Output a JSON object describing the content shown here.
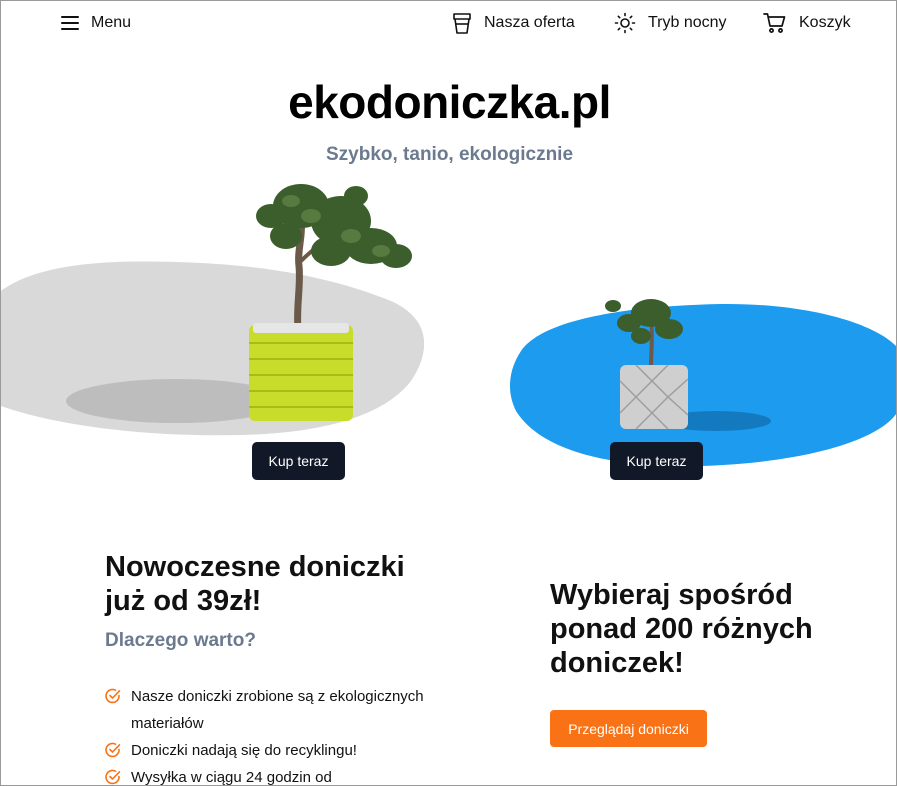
{
  "header": {
    "menu_label": "Menu",
    "offer_label": "Nasza oferta",
    "night_mode_label": "Tryb nocny",
    "cart_label": "Koszyk"
  },
  "hero": {
    "site_title": "ekodoniczka.pl",
    "tagline": "Szybko, tanio, ekologicznie",
    "products": [
      {
        "buy_label": "Kup teraz",
        "pot_color": "#c8dc2a",
        "blob_color": "#d9d9d9"
      },
      {
        "buy_label": "Kup teraz",
        "pot_color": "#cfcfcf",
        "blob_color": "#1c9bef"
      }
    ]
  },
  "left": {
    "title": "Nowoczesne doniczki już od 39zł!",
    "subtitle": "Dlaczego warto?",
    "features": [
      "Nasze doniczki zrobione są z ekologicznych materiałów",
      "Doniczki nadają się do recyklingu!",
      "Wysyłka w ciągu 24 godzin od"
    ]
  },
  "right": {
    "title": "Wybieraj spośród ponad 200 różnych doniczek!",
    "browse_label": "Przeglądaj doniczki"
  },
  "colors": {
    "accent": "#f97316",
    "dark_button": "#111827",
    "muted_text": "#6b7a8f",
    "blue": "#1c9bef"
  }
}
